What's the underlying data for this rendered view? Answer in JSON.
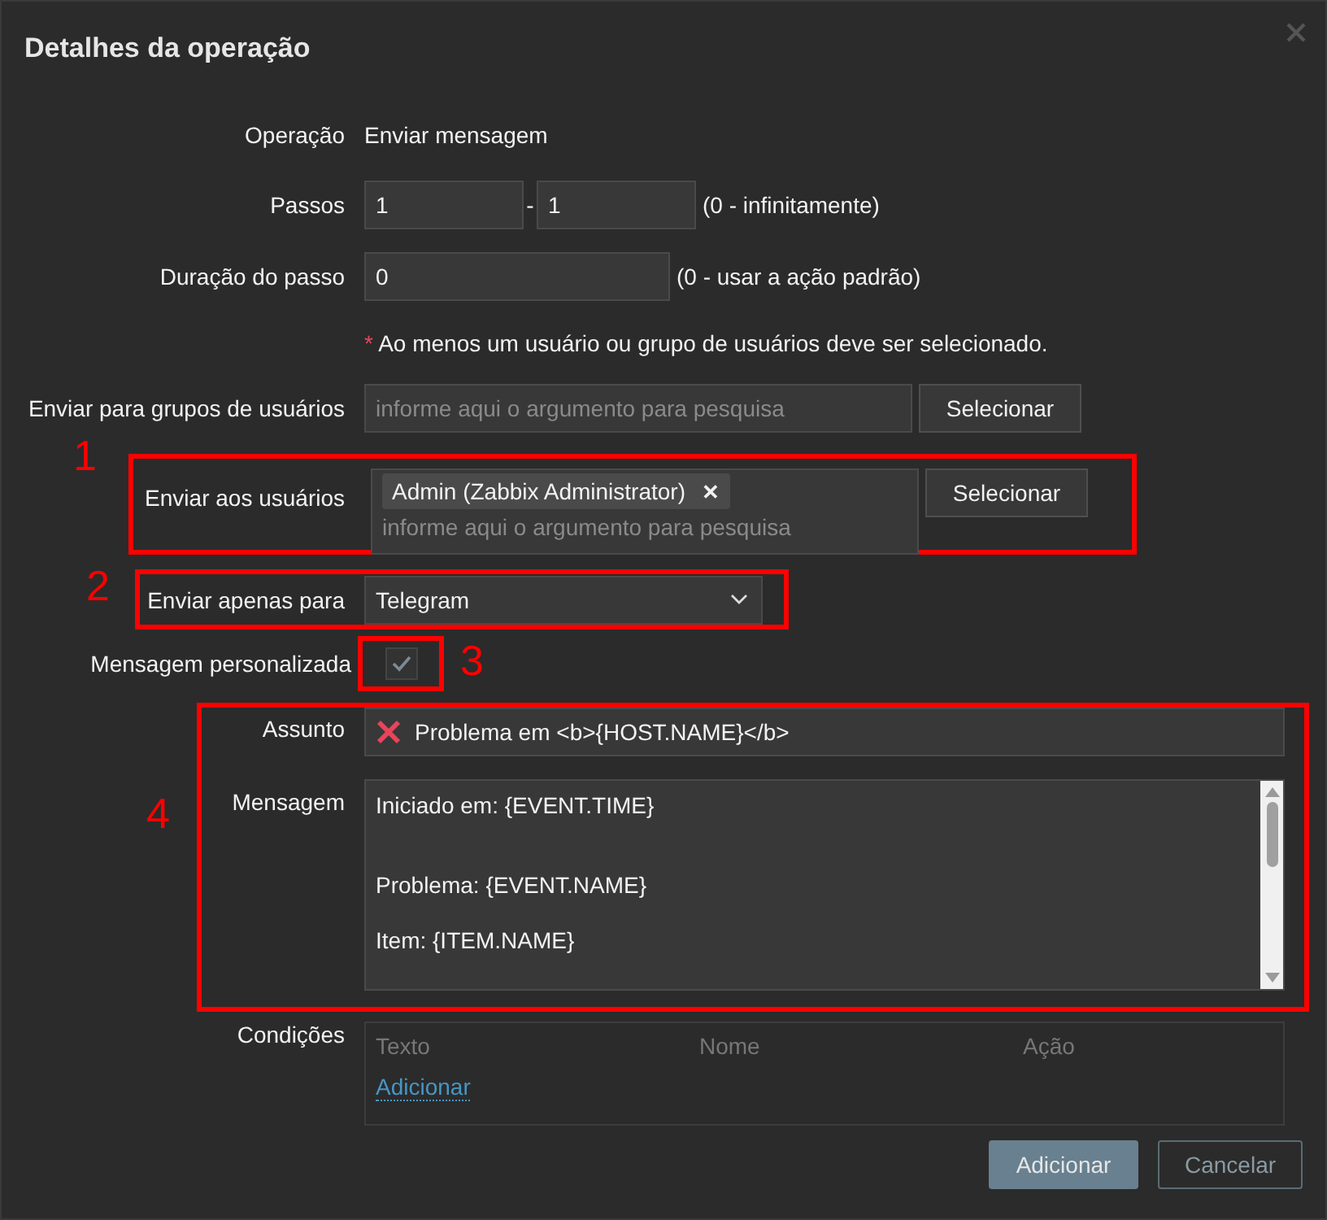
{
  "dialog": {
    "title": "Detalhes da operação"
  },
  "fields": [
    {
      "kind": "text",
      "label": "Operação",
      "value": "Enviar mensagem"
    },
    {
      "kind": "steps",
      "label": "Passos",
      "from": "1",
      "separator": "-",
      "to": "1",
      "hint": "(0 - infinitamente)"
    },
    {
      "kind": "input",
      "label": "Duração do passo",
      "value": "0",
      "hint": "(0 - usar a ação padrão)"
    },
    {
      "kind": "note",
      "asterisk": "*",
      "text": "Ao menos um usuário ou grupo de usuários deve ser selecionado."
    },
    {
      "kind": "multiselect",
      "label": "Enviar para grupos de usuários",
      "placeholder": "informe aqui o argumento para pesquisa",
      "button": "Selecionar"
    },
    {
      "kind": "multiselect",
      "label": "Enviar aos usuários",
      "annotation": "1",
      "tags": [
        {
          "text": "Admin (Zabbix Administrator)",
          "remove": "✕"
        }
      ],
      "placeholder": "informe aqui o argumento para pesquisa",
      "button": "Selecionar"
    },
    {
      "kind": "select",
      "label": "Enviar apenas para",
      "annotation": "2",
      "value": "Telegram"
    },
    {
      "kind": "checkbox",
      "label": "Mensagem personalizada",
      "annotation": "3",
      "checked": true,
      "disabled": true
    },
    {
      "kind": "group",
      "annotation": "4",
      "fields": [
        {
          "kind": "subject",
          "label": "Assunto",
          "value": "Problema em <b>{HOST.NAME}</b>",
          "invalid": true
        },
        {
          "kind": "textarea",
          "label": "Mensagem",
          "lines": [
            "Iniciado em: {EVENT.TIME}",
            "Problema: {EVENT.NAME}",
            "Item: {ITEM.NAME}"
          ]
        }
      ]
    },
    {
      "kind": "conditions",
      "label": "Condições",
      "columns": [
        "Texto",
        "Nome",
        "Ação"
      ],
      "link": "Adicionar"
    }
  ],
  "buttons": [
    {
      "label": "Adicionar",
      "kind": "primary"
    },
    {
      "label": "Cancelar",
      "kind": "secondary"
    }
  ]
}
